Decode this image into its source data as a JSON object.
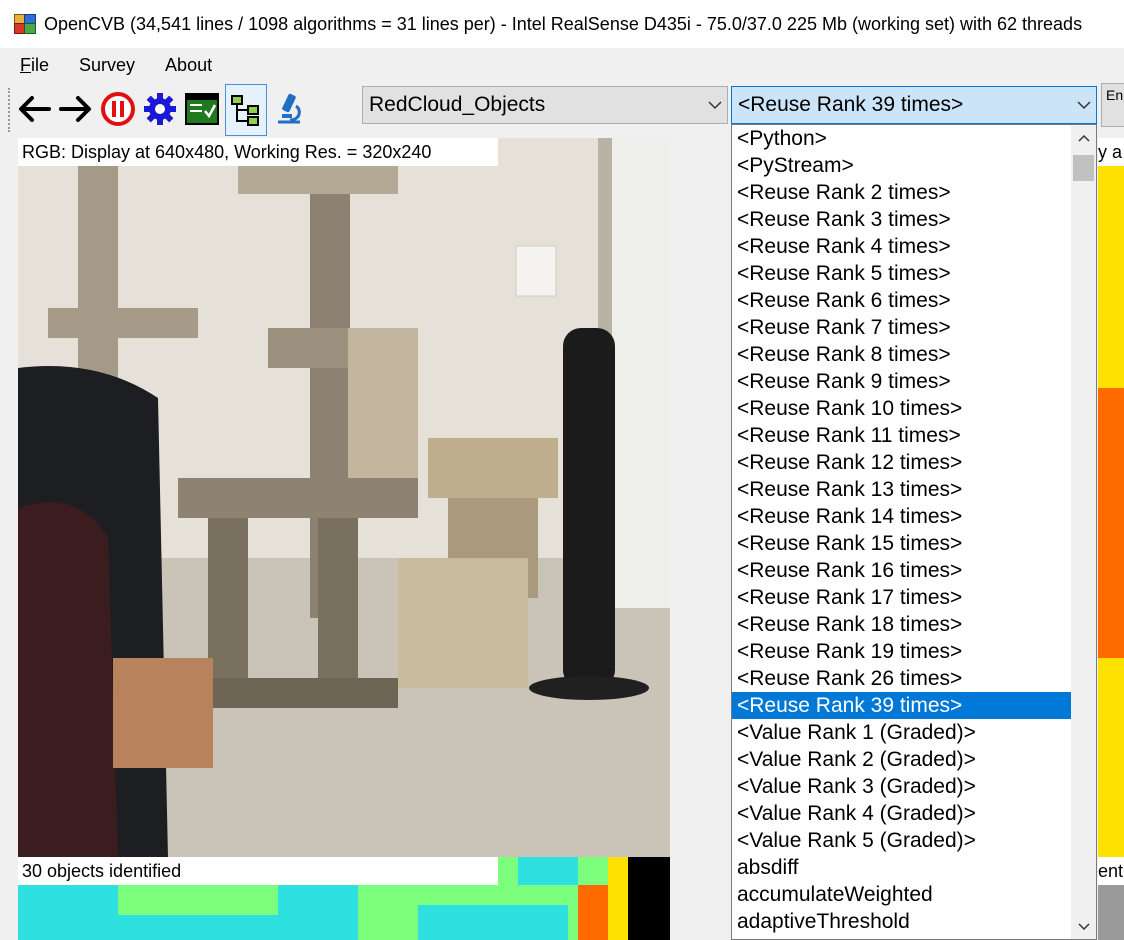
{
  "window": {
    "title": "OpenCVB (34,541 lines / 1098 algorithms = 31 lines per) - Intel RealSense D435i - 75.0/37.0 225 Mb (working set) with 62 threads"
  },
  "menu": {
    "items": [
      {
        "label": "File",
        "mnemonic": "F",
        "rest": "ile"
      },
      {
        "label": "Survey"
      },
      {
        "label": "About"
      }
    ]
  },
  "toolbar": {
    "icons": [
      "back-arrow-icon",
      "forward-arrow-icon",
      "pause-icon",
      "settings-gear-icon",
      "options-window-icon",
      "tree-view-icon",
      "microscope-icon"
    ],
    "algorithm_combo": "RedCloud_Objects",
    "group_combo": "<Reuse Rank 39 times>",
    "side_button": "En"
  },
  "views": {
    "rgb_label": "RGB: Display at 640x480, Working Res. = 320x240",
    "objects_label": "30 objects identified",
    "right_label_top": "y a",
    "right_label_bottom": "ent"
  },
  "dropdown": {
    "selected_index": 21,
    "items": [
      "<Python>",
      "<PyStream>",
      "<Reuse Rank 2 times>",
      "<Reuse Rank 3 times>",
      "<Reuse Rank 4 times>",
      "<Reuse Rank 5 times>",
      "<Reuse Rank 6 times>",
      "<Reuse Rank 7 times>",
      "<Reuse Rank 8 times>",
      "<Reuse Rank 9 times>",
      "<Reuse Rank 10 times>",
      "<Reuse Rank 11 times>",
      "<Reuse Rank 12 times>",
      "<Reuse Rank 13 times>",
      "<Reuse Rank 14 times>",
      "<Reuse Rank 15 times>",
      "<Reuse Rank 16 times>",
      "<Reuse Rank 17 times>",
      "<Reuse Rank 18 times>",
      "<Reuse Rank 19 times>",
      "<Reuse Rank 26 times>",
      "<Reuse Rank 39 times>",
      "<Value Rank 1 (Graded)>",
      "<Value Rank 2 (Graded)>",
      "<Value Rank 3 (Graded)>",
      "<Value Rank 4 (Graded)>",
      "<Value Rank 5 (Graded)>",
      "absdiff",
      "accumulateWeighted",
      "adaptiveThreshold"
    ]
  },
  "colors": {
    "selection": "#0078d7",
    "pause_red": "#e01010",
    "gear_blue": "#1a1ad6",
    "mask_cyan": "#2ee0e0",
    "mask_green": "#7cff7c",
    "mask_orange": "#ff6a00"
  }
}
